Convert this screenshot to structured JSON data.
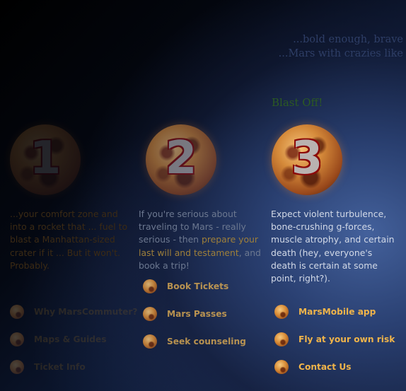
{
  "intro": {
    "line1": "...bold enough, brave",
    "line2": "...Mars with crazies like"
  },
  "blast_off": "Blast Off!",
  "steps": [
    {
      "number": "1",
      "text": "...your comfort zone and into a rocket that ... fuel to blast a Manhattan-sized crater if it ... But it won't. Probably."
    },
    {
      "number": "2",
      "text_before": "If you're serious about traveling to Mars - really serious - then ",
      "highlight": "prepare your last will and testament",
      "text_after": ", and book a trip!"
    },
    {
      "number": "3",
      "text": "Expect violent turbulence, bone-crushing g-forces, muscle atrophy, and certain death (hey, everyone's death is certain at some point, right?)."
    }
  ],
  "links_col1": [
    "Why MarsCommuter?",
    "Maps & Guides",
    "Ticket Info"
  ],
  "links_col2": [
    "Book Tickets",
    "Mars Passes",
    "Seek counseling"
  ],
  "links_col3": [
    "MarsMobile app",
    "Fly at your own risk",
    "Contact Us"
  ]
}
